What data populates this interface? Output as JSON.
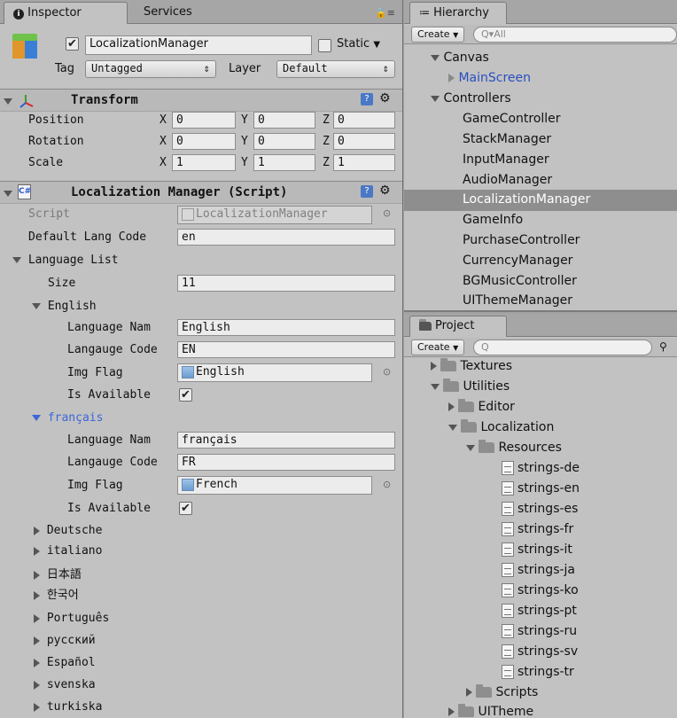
{
  "inspector": {
    "tabs": [
      "Inspector",
      "Services"
    ],
    "object": {
      "name": "LocalizationManager",
      "static_label": "Static",
      "tag_label": "Tag",
      "tag_value": "Untagged",
      "layer_label": "Layer",
      "layer_value": "Default"
    },
    "transform": {
      "title": "Transform",
      "rows": [
        {
          "label": "Position",
          "x": "0",
          "y": "0",
          "z": "0"
        },
        {
          "label": "Rotation",
          "x": "0",
          "y": "0",
          "z": "0"
        },
        {
          "label": "Scale",
          "x": "1",
          "y": "1",
          "z": "1"
        }
      ],
      "axis": [
        "X",
        "Y",
        "Z"
      ]
    },
    "script": {
      "title": "Localization Manager (Script)",
      "script_label": "Script",
      "script_value": "LocalizationManager",
      "default_lang_label": "Default Lang Code",
      "default_lang_value": "en",
      "language_list_label": "Language List",
      "size_label": "Size",
      "size_value": "11",
      "english": {
        "header": "English",
        "name_label": "Language Nam",
        "name_value": "English",
        "code_label": "Langauge Code",
        "code_value": "EN",
        "flag_label": "Img Flag",
        "flag_value": "English",
        "available_label": "Is Available"
      },
      "francais": {
        "header": "français",
        "name_label": "Language Nam",
        "name_value": "français",
        "code_label": "Langauge Code",
        "code_value": "FR",
        "flag_label": "Img Flag",
        "flag_value": "French",
        "available_label": "Is Available"
      },
      "collapsed": [
        "Deutsche",
        "italiano",
        "日本語",
        "한국어",
        "Português",
        "русский",
        "Español",
        "svenska",
        "turkiska"
      ]
    }
  },
  "hierarchy": {
    "tab": "Hierarchy",
    "create_label": "Create",
    "search_placeholder": "All",
    "items": [
      {
        "label": "Canvas"
      },
      {
        "label": "MainScreen"
      },
      {
        "label": "Controllers"
      },
      {
        "label": "GameController"
      },
      {
        "label": "StackManager"
      },
      {
        "label": "InputManager"
      },
      {
        "label": "AudioManager"
      },
      {
        "label": "LocalizationManager"
      },
      {
        "label": "GameInfo"
      },
      {
        "label": "PurchaseController"
      },
      {
        "label": "CurrencyManager"
      },
      {
        "label": "BGMusicController"
      },
      {
        "label": "UIThemeManager"
      }
    ]
  },
  "project": {
    "tab": "Project",
    "create_label": "Create",
    "items": [
      {
        "label": "Textures"
      },
      {
        "label": "Utilities"
      },
      {
        "label": "Editor"
      },
      {
        "label": "Localization"
      },
      {
        "label": "Resources"
      },
      {
        "label": "strings-de"
      },
      {
        "label": "strings-en"
      },
      {
        "label": "strings-es"
      },
      {
        "label": "strings-fr"
      },
      {
        "label": "strings-it"
      },
      {
        "label": "strings-ja"
      },
      {
        "label": "strings-ko"
      },
      {
        "label": "strings-pt"
      },
      {
        "label": "strings-ru"
      },
      {
        "label": "strings-sv"
      },
      {
        "label": "strings-tr"
      },
      {
        "label": "Scripts"
      },
      {
        "label": "UITheme"
      }
    ]
  }
}
